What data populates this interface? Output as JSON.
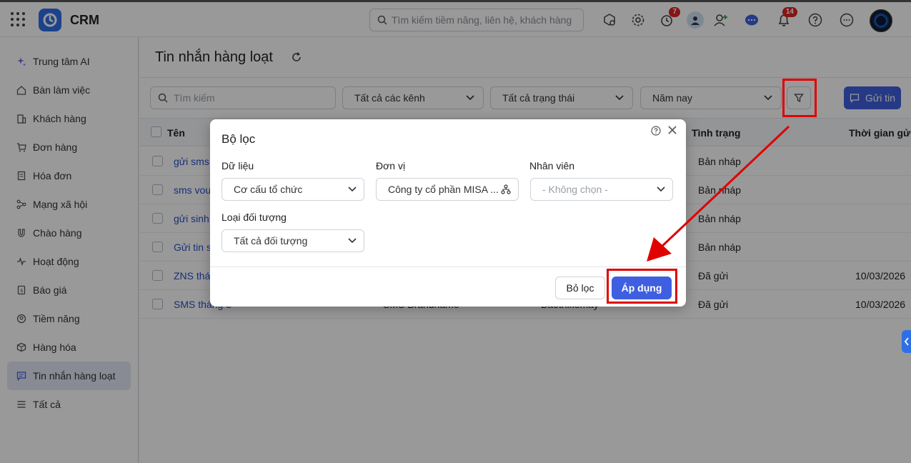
{
  "app": {
    "name": "CRM"
  },
  "header": {
    "search_placeholder": "Tìm kiếm tiềm năng, liên hệ, khách hàng",
    "timer_badge": "7",
    "bell_badge": "14"
  },
  "sidebar": {
    "items": [
      {
        "label": "Trung tâm AI",
        "icon": "sparkle-icon"
      },
      {
        "label": "Bàn làm việc",
        "icon": "home-icon"
      },
      {
        "label": "Khách hàng",
        "icon": "building-icon"
      },
      {
        "label": "Đơn hàng",
        "icon": "cart-icon"
      },
      {
        "label": "Hóa đơn",
        "icon": "invoice-icon"
      },
      {
        "label": "Mạng xã hội",
        "icon": "share-icon"
      },
      {
        "label": "Chào hàng",
        "icon": "magnet-icon"
      },
      {
        "label": "Hoạt động",
        "icon": "activity-icon"
      },
      {
        "label": "Báo giá",
        "icon": "quote-icon"
      },
      {
        "label": "Tiềm năng",
        "icon": "prospect-icon"
      },
      {
        "label": "Hàng hóa",
        "icon": "box-icon"
      },
      {
        "label": "Tin nhắn hàng loạt",
        "icon": "message-icon",
        "active": true
      },
      {
        "label": "Tất cả",
        "icon": "menu-icon"
      }
    ]
  },
  "page": {
    "title": "Tin nhắn hàng loạt",
    "search_placeholder": "Tìm kiếm",
    "channel_filter": "Tất cả các kênh",
    "status_filter": "Tất cả trạng thái",
    "period_filter": "Năm nay",
    "send_label": "Gửi tin"
  },
  "table": {
    "headers": {
      "name": "Tên",
      "status": "Tình trạng",
      "sent_time": "Thời gian gửi"
    },
    "rows": [
      {
        "name": "gửi sms",
        "channel": "",
        "owner": "",
        "status": "Bản nháp",
        "sent_time": ""
      },
      {
        "name": "sms vou",
        "channel": "",
        "owner": "",
        "status": "Bản nháp",
        "sent_time": ""
      },
      {
        "name": "gửi sinh",
        "channel": "",
        "owner": "",
        "status": "Bản nháp",
        "sent_time": ""
      },
      {
        "name": "Gửi tin s",
        "channel": "",
        "owner": "",
        "status": "Bản nháp",
        "sent_time": ""
      },
      {
        "name": "ZNS thán",
        "channel": "",
        "owner": "",
        "status": "Đã gửi",
        "sent_time": "10/03/2026"
      },
      {
        "name": "SMS tháng 3",
        "channel": "SMS Brandname",
        "owner": "Baothixemay",
        "status": "Đã gửi",
        "sent_time": "10/03/2026"
      }
    ]
  },
  "modal": {
    "title": "Bộ lọc",
    "data_label": "Dữ liệu",
    "data_value": "Cơ cấu tổ chức",
    "unit_label": "Đơn vị",
    "unit_value": "Công ty cổ phần MISA ...",
    "staff_label": "Nhân viên",
    "staff_placeholder": "- Không chọn -",
    "object_type_label": "Loại đối tượng",
    "object_type_value": "Tất cả đối tượng",
    "clear_label": "Bỏ lọc",
    "apply_label": "Áp dụng"
  },
  "colors": {
    "accent": "#3f5fe0",
    "highlight": "#e00000",
    "badge": "#e02424"
  }
}
